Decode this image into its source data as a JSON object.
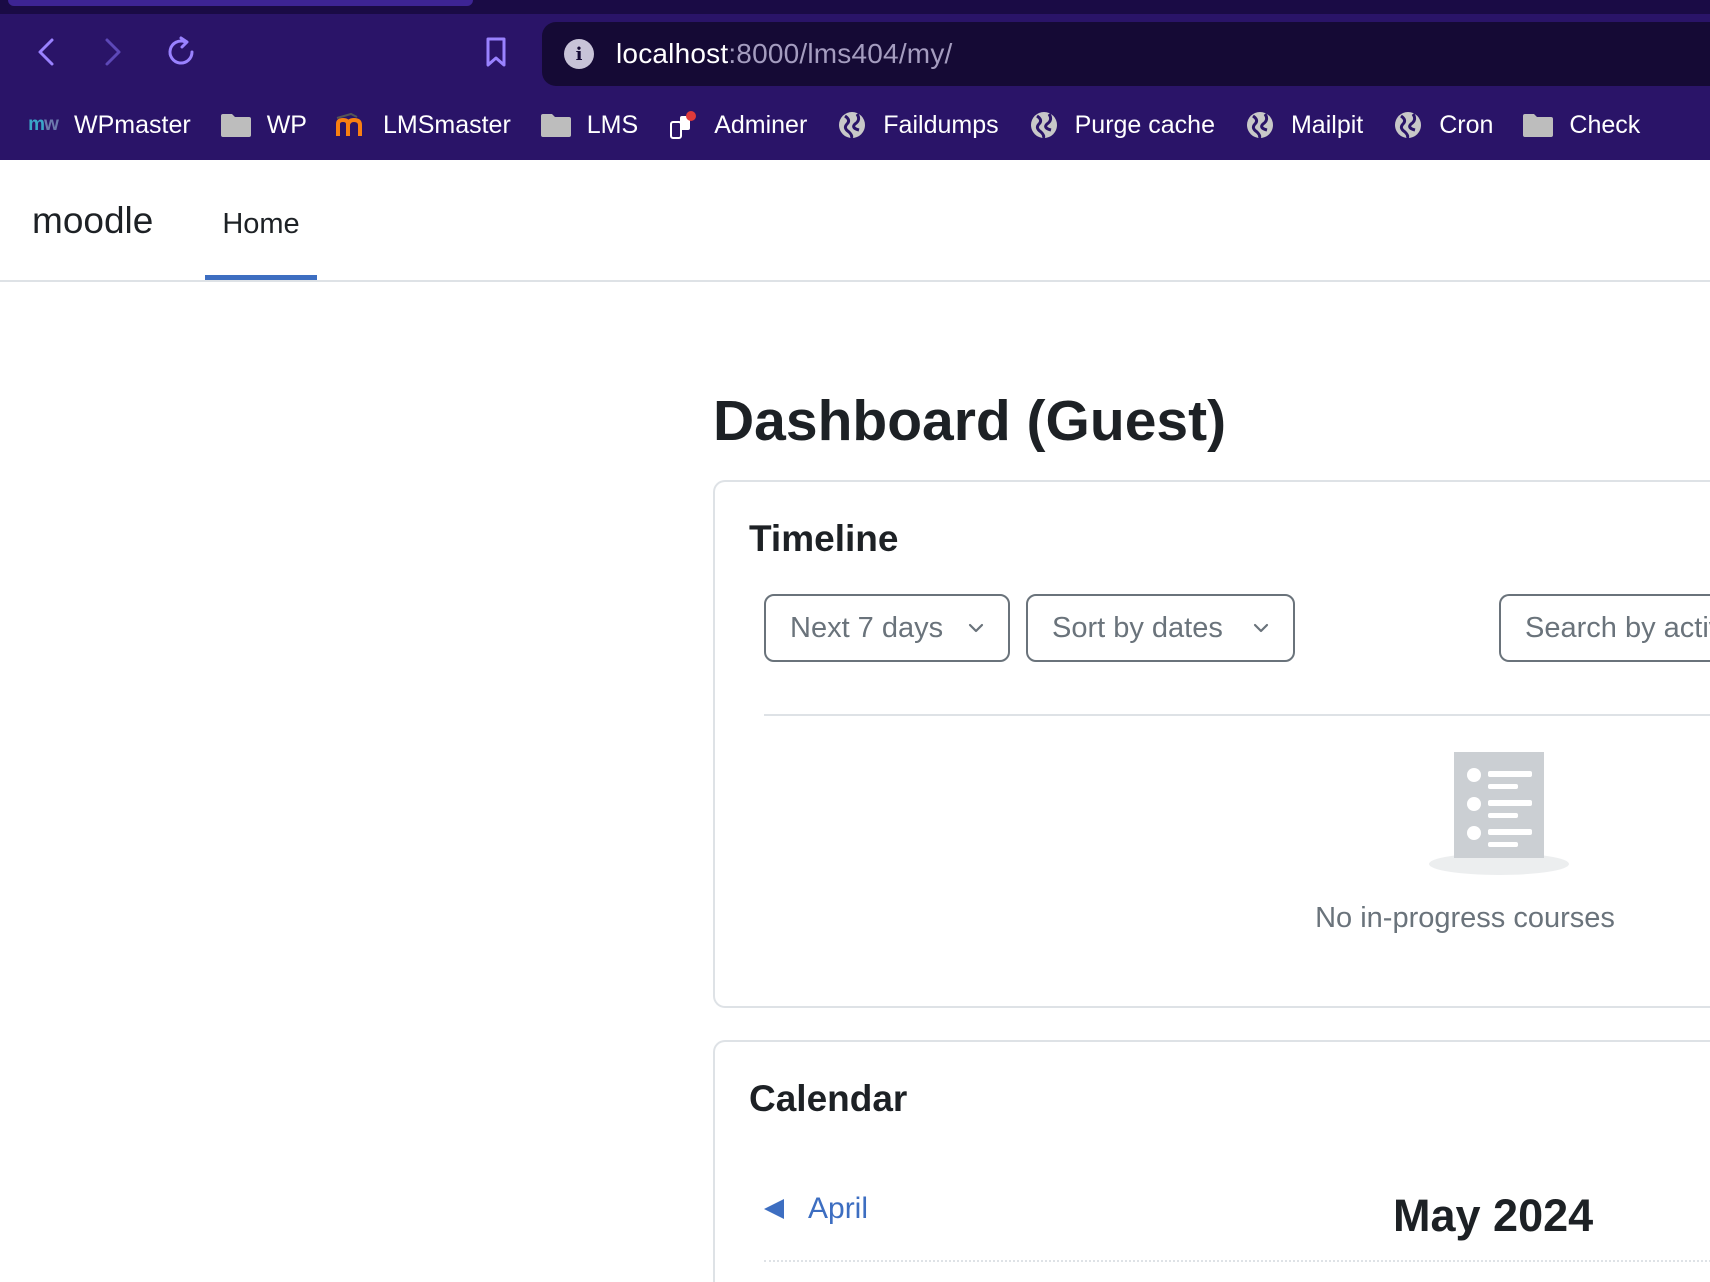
{
  "browser": {
    "address": {
      "host": "localhost",
      "path": ":8000/lms404/my/"
    },
    "bookmarks": [
      {
        "label": "WPmaster",
        "icon": "mw-logo-icon"
      },
      {
        "label": "WP",
        "icon": "folder-icon"
      },
      {
        "label": "LMSmaster",
        "icon": "moodle-logo-icon"
      },
      {
        "label": "LMS",
        "icon": "folder-icon"
      },
      {
        "label": "Adminer",
        "icon": "adminer-icon"
      },
      {
        "label": "Faildumps",
        "icon": "globe-icon"
      },
      {
        "label": "Purge cache",
        "icon": "globe-icon"
      },
      {
        "label": "Mailpit",
        "icon": "globe-icon"
      },
      {
        "label": "Cron",
        "icon": "globe-icon"
      },
      {
        "label": "Check",
        "icon": "folder-icon"
      }
    ],
    "mw_logo": {
      "m": "m",
      "w": "w"
    }
  },
  "navbar": {
    "brand": "moodle",
    "home": "Home"
  },
  "page": {
    "title": "Dashboard (Guest)"
  },
  "timeline": {
    "title": "Timeline",
    "filter_label": "Next 7 days",
    "sort_label": "Sort by dates",
    "search_placeholder": "Search by activity type or name",
    "empty_text": "No in-progress courses"
  },
  "calendar": {
    "title": "Calendar",
    "prev_month": "April",
    "current_month": "May 2024"
  },
  "colors": {
    "chrome_bg": "#2a1468",
    "address_bg": "#150a35",
    "accent": "#3d6ec1",
    "muted_text": "#6a737b"
  }
}
